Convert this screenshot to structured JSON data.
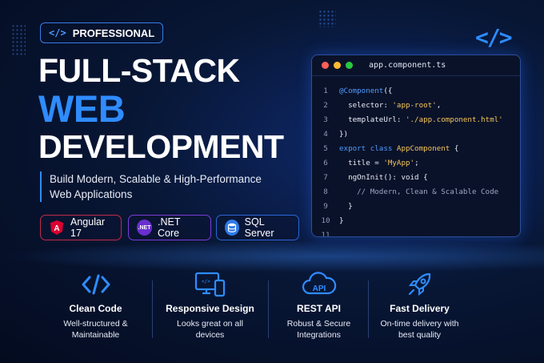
{
  "badge": {
    "icon": "code-tag-icon",
    "icon_text": "</>",
    "label": "PROFESSIONAL"
  },
  "title": {
    "line1": "FULL-STACK",
    "line2": "WEB",
    "line3": "DEVELOPMENT"
  },
  "subtitle": {
    "line1": "Build Modern, Scalable & High-Performance",
    "line2": "Web Applications"
  },
  "tech": [
    {
      "icon": "angular-icon",
      "icon_text": "A",
      "label": "Angular 17",
      "color": "#dd0031"
    },
    {
      "icon": "dotnet-icon",
      "icon_text": ".NET",
      "label": ".NET Core",
      "color": "#6a2fcf"
    },
    {
      "icon": "database-icon",
      "icon_text": "",
      "label": "SQL Server",
      "color": "#2f7ae8"
    }
  ],
  "editor": {
    "filename": "app.component.ts",
    "lines": [
      {
        "n": "1",
        "parts": [
          [
            "dec",
            "@Component"
          ],
          [
            "plain",
            "({"
          ]
        ]
      },
      {
        "n": "2",
        "parts": [
          [
            "plain",
            "  selector: "
          ],
          [
            "str",
            "'app-root'"
          ],
          [
            "plain",
            ","
          ]
        ]
      },
      {
        "n": "3",
        "parts": [
          [
            "plain",
            "  templateUrl: "
          ],
          [
            "str",
            "'./app.component.html'"
          ]
        ]
      },
      {
        "n": "4",
        "parts": [
          [
            "plain",
            "})"
          ]
        ]
      },
      {
        "n": "5",
        "parts": [
          [
            "kw",
            "export class "
          ],
          [
            "cls",
            "AppComponent"
          ],
          [
            "plain",
            " {"
          ]
        ]
      },
      {
        "n": "6",
        "parts": [
          [
            "plain",
            "  title = "
          ],
          [
            "str",
            "'MyApp'"
          ],
          [
            "plain",
            ";"
          ]
        ]
      },
      {
        "n": "7",
        "parts": [
          [
            "plain",
            "  ngOnInit(): void {"
          ]
        ]
      },
      {
        "n": "8",
        "parts": [
          [
            "cm",
            "    // Modern, Clean & Scalable Code"
          ]
        ]
      },
      {
        "n": "9",
        "parts": [
          [
            "plain",
            "  }"
          ]
        ]
      },
      {
        "n": "10",
        "parts": [
          [
            "plain",
            "}"
          ]
        ]
      },
      {
        "n": "11",
        "parts": []
      }
    ]
  },
  "features": [
    {
      "icon": "code-brackets-icon",
      "title": "Clean Code",
      "desc1": "Well-structured &",
      "desc2": "Maintainable"
    },
    {
      "icon": "devices-icon",
      "title": "Responsive Design",
      "desc1": "Looks great on all",
      "desc2": "devices"
    },
    {
      "icon": "cloud-api-icon",
      "title": "REST API",
      "desc1": "Robust & Secure",
      "desc2": "Integrations"
    },
    {
      "icon": "rocket-icon",
      "title": "Fast Delivery",
      "desc1": "On-time delivery with",
      "desc2": "best quality"
    }
  ],
  "colors": {
    "accent": "#2f8cff",
    "angular": "#dd0031",
    "dotnet": "#6a2fcf",
    "sql": "#2f7ae8",
    "background": "#081736"
  }
}
